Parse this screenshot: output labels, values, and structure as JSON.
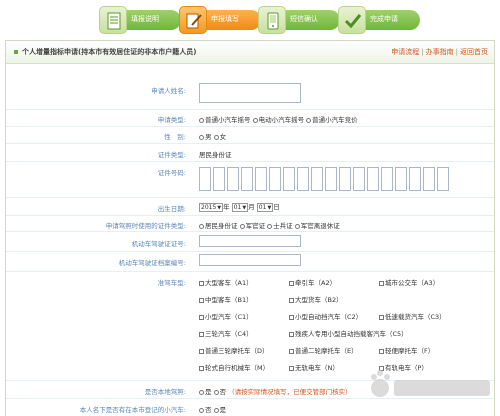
{
  "steps": [
    {
      "label": "填报说明",
      "icon": "document-icon",
      "active": false
    },
    {
      "label": "申报填写",
      "icon": "edit-icon",
      "active": true
    },
    {
      "label": "短信确认",
      "icon": "phone-message-icon",
      "active": false
    },
    {
      "label": "完成申请",
      "icon": "checkmark-icon",
      "active": false
    }
  ],
  "header": {
    "title": "个人增量指标申请(持本市有效居住证的非本市户籍人员)",
    "links": [
      "申请流程",
      "办事指南",
      "返回首页"
    ]
  },
  "form": {
    "name_label": "申请人姓名:",
    "type_label": "申请类型:",
    "type_options": [
      "普通小汽车摇号",
      "电动小汽车摇号",
      "普通小汽车竞价"
    ],
    "gender_label": "性　别:",
    "gender_options": [
      "男",
      "女"
    ],
    "idtype_label": "证件类型:",
    "idtype_value": "居民身份证",
    "idnum_label": "证件号码:",
    "birth_label": "出生日期:",
    "birth_year": "2015",
    "birth_year_unit": "年",
    "birth_month": "01",
    "birth_month_unit": "月",
    "birth_day": "01",
    "birth_day_unit": "日",
    "license_type_label": "申请驾照时使用的证件类型:",
    "license_type_options": [
      "居民身份证",
      "军官证",
      "士兵证",
      "军官离退休证"
    ],
    "license_no_label": "机动车驾驶证证号:",
    "license_file_label": "机动车驾驶证档案编号:",
    "vehicle_label": "准驾车型:",
    "vehicle_types": [
      [
        "大型客车（A1）",
        "牵引车（A2）",
        "城市公交车（A3）"
      ],
      [
        "中型客车（B1）",
        "大型货车（B2）",
        ""
      ],
      [
        "小型汽车（C1）",
        "小型自动挡汽车（C2）",
        "低速载货汽车（C3）"
      ],
      [
        "三轮汽车（C4）",
        "残疾人专用小型自动挡载客汽车（C5）",
        ""
      ],
      [
        "普通三轮摩托车（D）",
        "普通二轮摩托车（E）",
        "轻便摩托车（F）"
      ],
      [
        "轮式自行机械车（M）",
        "无轨电车（N）",
        "有轨电车（P）"
      ]
    ],
    "local_license_label": "是否本地驾照:",
    "local_license_options": [
      "是",
      "否"
    ],
    "local_license_note": "（请按实际情况填写，已便交管部门核实）",
    "owner_label": "本人名下是否有在本市登记的小汽车:",
    "owner_options": [
      "否",
      "是"
    ]
  }
}
